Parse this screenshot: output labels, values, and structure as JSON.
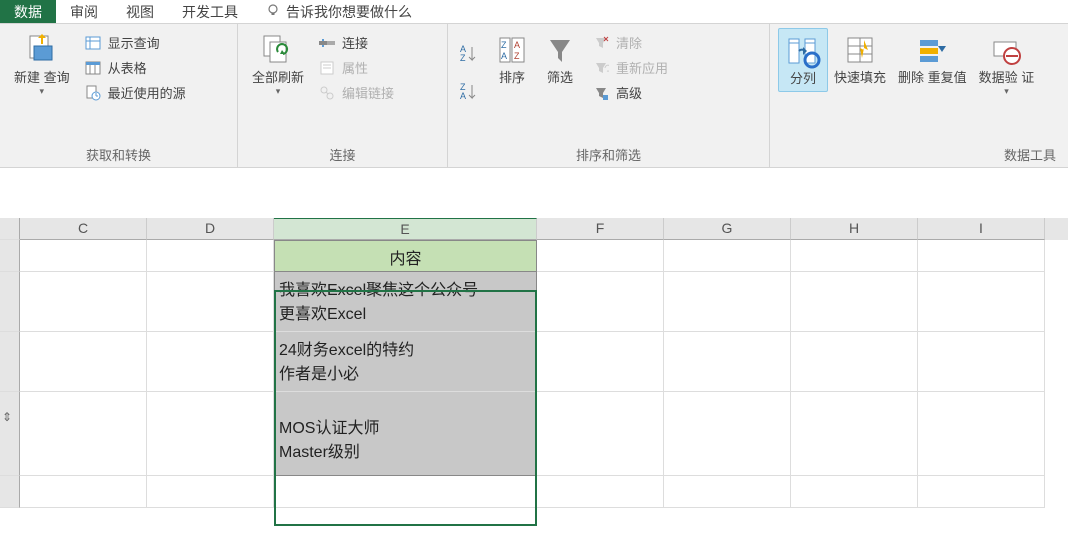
{
  "tabs": {
    "data": "数据",
    "review": "审阅",
    "view": "视图",
    "dev": "开发工具",
    "tell": "告诉我你想要做什么"
  },
  "ribbon": {
    "acquire": {
      "newQuery": "新建\n查询",
      "showQuery": "显示查询",
      "fromTable": "从表格",
      "recent": "最近使用的源",
      "groupLabel": "获取和转换"
    },
    "connections": {
      "refreshAll": "全部刷新",
      "connections": "连接",
      "properties": "属性",
      "editLinks": "编辑链接",
      "groupLabel": "连接"
    },
    "sortFilter": {
      "sort": "排序",
      "filter": "筛选",
      "clear": "清除",
      "reapply": "重新应用",
      "advanced": "高级",
      "groupLabel": "排序和筛选"
    },
    "dataTools": {
      "textToColumns": "分列",
      "flashFill": "快速填充",
      "removeDup": "删除\n重复值",
      "dataValidation": "数据验\n证",
      "groupLabel": "数据工具"
    }
  },
  "columns": [
    "C",
    "D",
    "E",
    "F",
    "G",
    "H",
    "I"
  ],
  "sheet": {
    "header": "内容",
    "rows": [
      "我喜欢Excel聚焦这个公众号\n更喜欢Excel",
      "24财务excel的特约\n作者是小必",
      "\nMOS认证大师\nMaster级别"
    ]
  }
}
